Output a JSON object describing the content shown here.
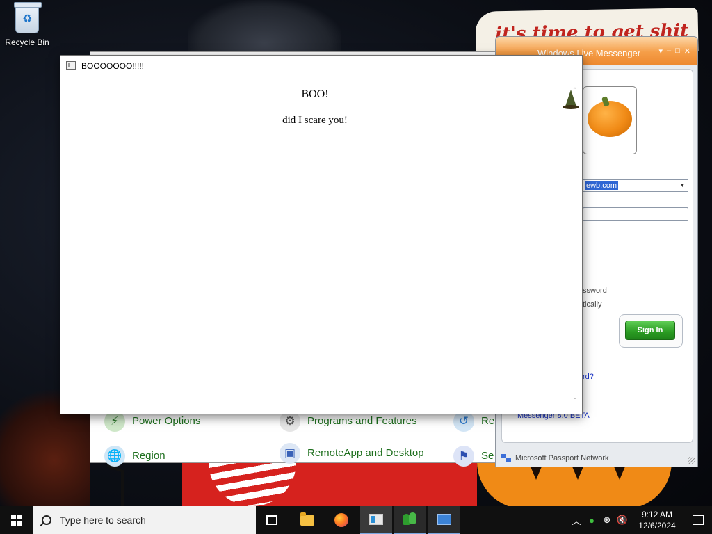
{
  "desktop": {
    "recycle_bin_label": "Recycle Bin",
    "wallpaper_text": "it's time to get shit"
  },
  "boo_window": {
    "title": "BOOOOOOO!!!!!",
    "heading": "BOO!",
    "text": "did I scare you!"
  },
  "control_panel": {
    "items": [
      {
        "label": "Power Options",
        "icon": "power-options-icon"
      },
      {
        "label": "Programs and Features",
        "icon": "programs-features-icon"
      },
      {
        "label": "Re",
        "icon": "recovery-icon"
      },
      {
        "label": "Region",
        "icon": "region-icon"
      },
      {
        "label": "RemoteApp and Desktop",
        "icon": "remoteapp-icon"
      },
      {
        "label": "Se",
        "icon": "security-icon"
      }
    ]
  },
  "messenger": {
    "title": "Windows Live Messenger",
    "email_value": "ewb.com",
    "remember_password_fragment": "ssword",
    "sign_in_auto_fragment": "tically",
    "forgot_password_fragment": "rd?",
    "version_link": "Messenger 8.0 BETA",
    "sign_in_button": "Sign In",
    "footer": "Microsoft Passport Network"
  },
  "taskbar": {
    "search_placeholder": "Type here to search",
    "time": "9:12 AM",
    "date": "12/6/2024",
    "apps": [
      "task-view",
      "file-explorer",
      "firefox",
      "boo-app",
      "messenger",
      "control-panel"
    ]
  },
  "colors": {
    "taskbar_bg": "#101010",
    "messenger_orange": "#f59e48",
    "sign_in_green": "#2a9b22",
    "control_panel_link": "#1e6f1e"
  }
}
